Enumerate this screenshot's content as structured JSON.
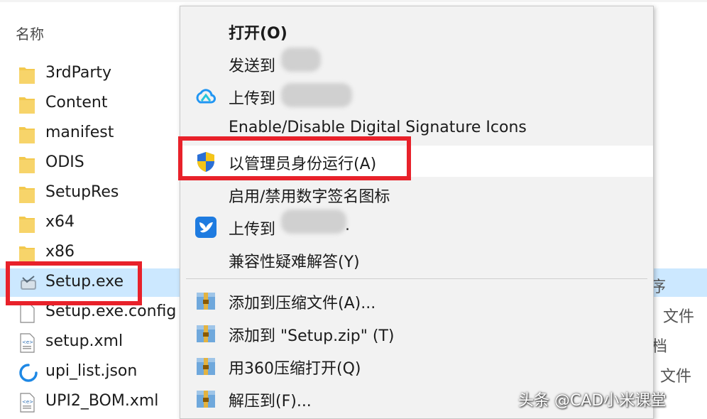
{
  "explorer": {
    "column_name": "名称",
    "files": [
      {
        "name": "3rdParty",
        "icon": "folder-icon"
      },
      {
        "name": "Content",
        "icon": "folder-icon"
      },
      {
        "name": "manifest",
        "icon": "folder-icon"
      },
      {
        "name": "ODIS",
        "icon": "folder-icon"
      },
      {
        "name": "SetupRes",
        "icon": "folder-icon"
      },
      {
        "name": "x64",
        "icon": "folder-icon"
      },
      {
        "name": "x86",
        "icon": "folder-icon"
      },
      {
        "name": "Setup.exe",
        "icon": "setup-exe-icon",
        "selected": true
      },
      {
        "name": "Setup.exe.config",
        "icon": "config-file-icon"
      },
      {
        "name": "setup.xml",
        "icon": "xml-file-icon"
      },
      {
        "name": "upi_list.json",
        "icon": "json-file-icon"
      },
      {
        "name": "UPI2_BOM.xml",
        "icon": "xml-file-icon"
      }
    ],
    "type_fragments": [
      "序",
      "文件",
      "档",
      "文件"
    ]
  },
  "context_menu": {
    "items": [
      {
        "label": "打开(O)",
        "bold": true,
        "icon": ""
      },
      {
        "label": "发送到",
        "icon": ""
      },
      {
        "label": "上传到",
        "icon": "cloud-upload-icon"
      },
      {
        "label": "Enable/Disable Digital Signature Icons",
        "icon": ""
      },
      {
        "label": "以管理员身份运行(A)",
        "icon": "uac-shield-icon",
        "hover": true
      },
      {
        "label": "启用/禁用数字签名图标",
        "icon": ""
      },
      {
        "label": "上传到",
        "icon": "bird-upload-icon",
        "suffix": "."
      },
      {
        "label": "兼容性疑难解答(Y)",
        "icon": ""
      },
      {
        "label": "添加到压缩文件(A)...",
        "icon": "winrar-archive-icon"
      },
      {
        "label": "添加到 \"Setup.zip\" (T)",
        "icon": "winrar-archive-icon"
      },
      {
        "label": "用360压缩打开(Q)",
        "icon": "winrar-archive-icon"
      },
      {
        "label": "解压到(F)...",
        "icon": "winrar-archive-icon"
      }
    ]
  },
  "watermark": "头条 @CAD小米课堂",
  "colors": {
    "highlight_box": "#e8212a",
    "selection": "#cce8ff",
    "menu_bg": "#f2f2f2",
    "folder": "#f3c94e"
  }
}
